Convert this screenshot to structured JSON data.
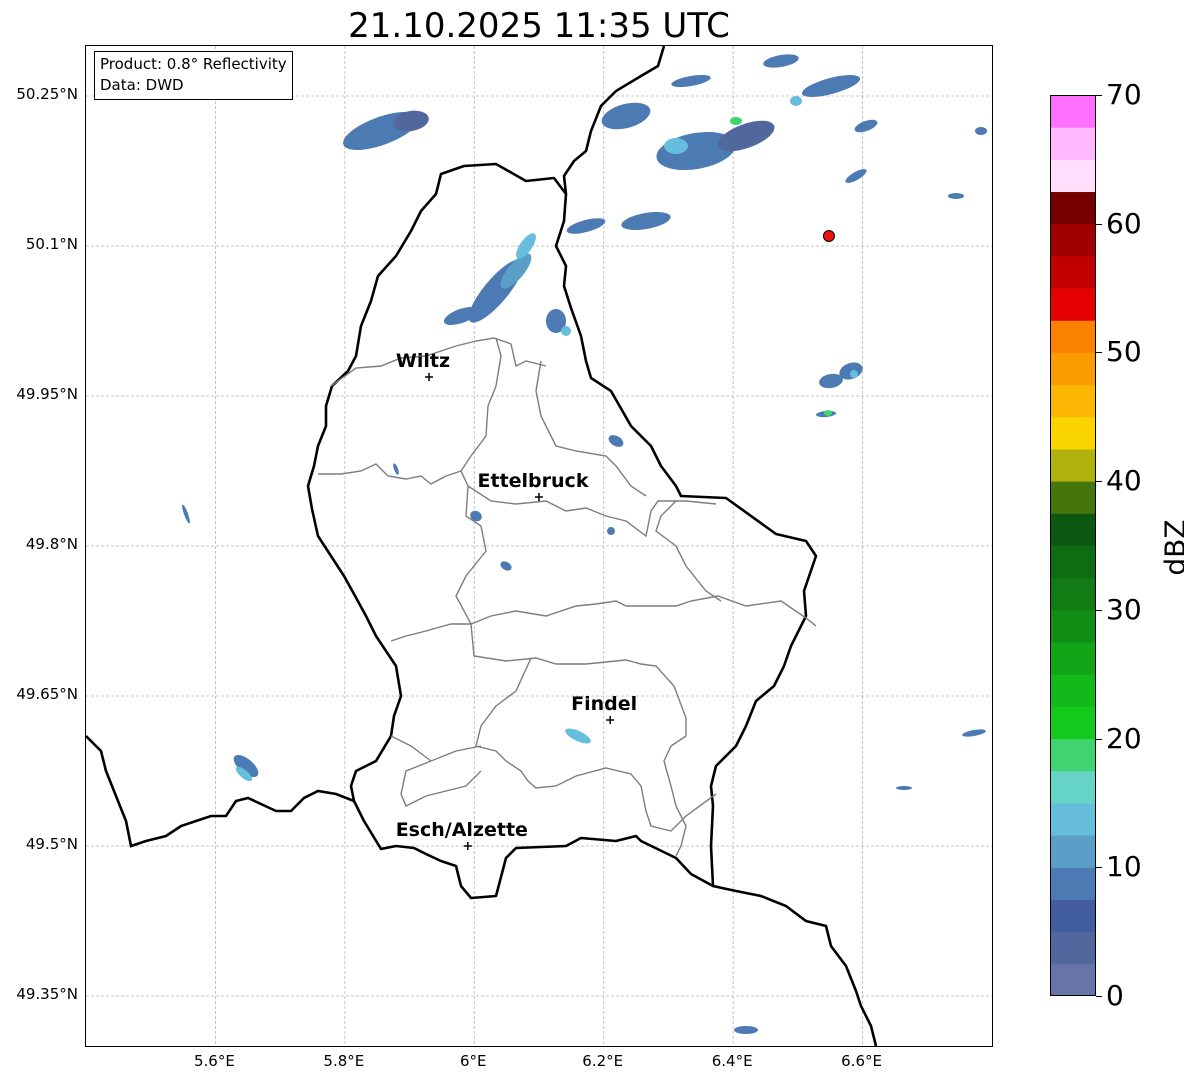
{
  "title": "21.10.2025 11:35 UTC",
  "info": {
    "product": "Product: 0.8° Reflectivity",
    "data_source": "Data: DWD"
  },
  "lat_ticks": [
    {
      "lat": 50.25,
      "label": "50.25°N"
    },
    {
      "lat": 50.1,
      "label": "50.1°N"
    },
    {
      "lat": 49.95,
      "label": "49.95°N"
    },
    {
      "lat": 49.8,
      "label": "49.8°N"
    },
    {
      "lat": 49.65,
      "label": "49.65°N"
    },
    {
      "lat": 49.5,
      "label": "49.5°N"
    },
    {
      "lat": 49.35,
      "label": "49.35°N"
    }
  ],
  "lon_ticks": [
    {
      "lon": 5.6,
      "label": "5.6°E"
    },
    {
      "lon": 5.8,
      "label": "5.8°E"
    },
    {
      "lon": 6.0,
      "label": "6°E"
    },
    {
      "lon": 6.2,
      "label": "6.2°E"
    },
    {
      "lon": 6.4,
      "label": "6.4°E"
    },
    {
      "lon": 6.6,
      "label": "6.6°E"
    }
  ],
  "extent": {
    "lon_min": 5.4,
    "lon_max": 6.8,
    "lat_min": 49.3,
    "lat_max": 50.3
  },
  "cities": [
    {
      "name": "Wiltz",
      "lon": 5.93,
      "lat": 49.969
    },
    {
      "name": "Ettelbruck",
      "lon": 6.1,
      "lat": 49.849
    },
    {
      "name": "Findel",
      "lon": 6.21,
      "lat": 49.626
    },
    {
      "name": "Esch/Alzette",
      "lon": 5.99,
      "lat": 49.5
    }
  ],
  "radar_site": {
    "lon": 6.548,
    "lat": 50.11,
    "color": "#ee1111"
  },
  "colorbar": {
    "label": "dBZ",
    "min": 0,
    "max": 70,
    "step": 2.5,
    "tick_values": [
      0,
      10,
      20,
      30,
      40,
      50,
      60,
      70
    ],
    "tick_labels": [
      "0",
      "10",
      "20",
      "30",
      "40",
      "50",
      "60",
      "70"
    ],
    "colors": [
      "#6674a8",
      "#53679f",
      "#425da0",
      "#4c7ab2",
      "#5b9ec8",
      "#66bedc",
      "#66d4c7",
      "#40d471",
      "#12c91c",
      "#13b81a",
      "#12a518",
      "#128d15",
      "#117c14",
      "#0e6d12",
      "#0b5810",
      "#45760b",
      "#b0b20b",
      "#fad500",
      "#fbb704",
      "#fa9c00",
      "#fb8200",
      "#e40000",
      "#c30000",
      "#a10000",
      "#760000",
      "#ffdffc",
      "#ffb7ff",
      "#ff6ffd",
      "#ec38ee"
    ]
  }
}
